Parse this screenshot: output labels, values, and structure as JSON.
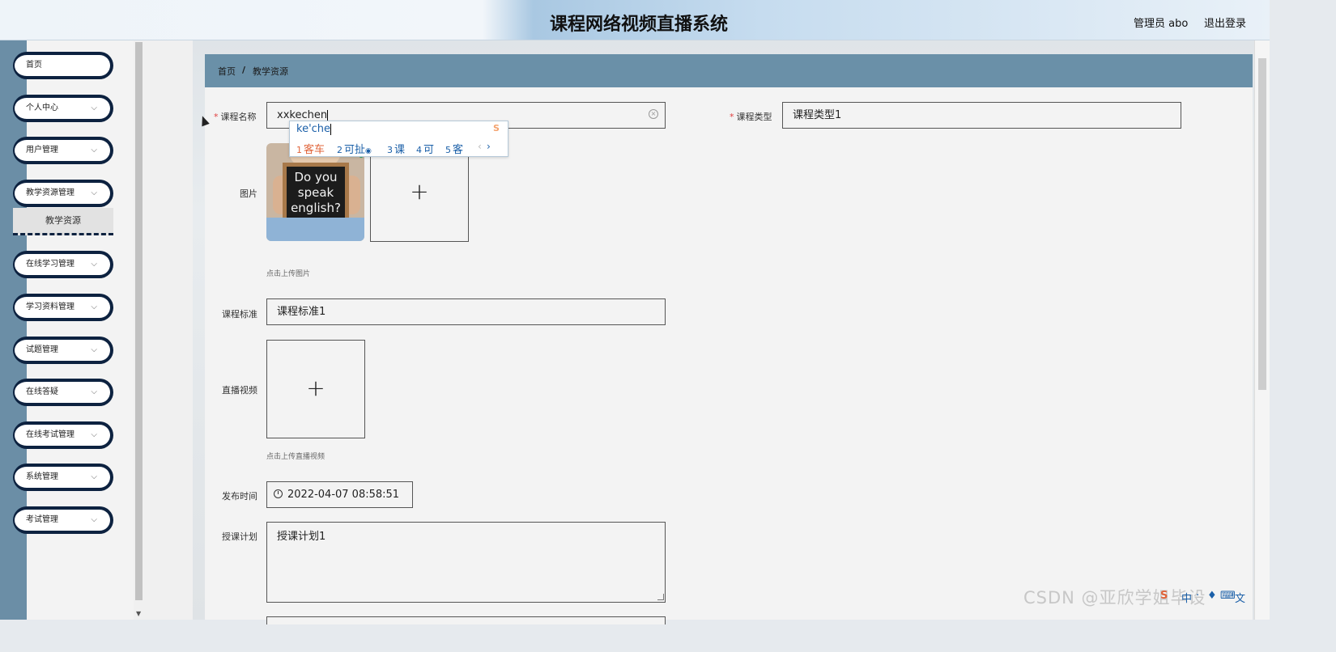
{
  "header": {
    "title": "课程网络视频直播系统",
    "user": "管理员 abo",
    "logout": "退出登录"
  },
  "sidebar": {
    "items": [
      {
        "label": "首页"
      },
      {
        "label": "个人中心"
      },
      {
        "label": "用户管理"
      },
      {
        "label": "教学资源管理"
      },
      {
        "label": "在线学习管理"
      },
      {
        "label": "学习资料管理"
      },
      {
        "label": "试题管理"
      },
      {
        "label": "在线答疑"
      },
      {
        "label": "在线考试管理"
      },
      {
        "label": "系统管理"
      },
      {
        "label": "考试管理"
      }
    ],
    "active_sub": "教学资源"
  },
  "breadcrumb": {
    "home": "首页",
    "sep": "/",
    "current": "教学资源"
  },
  "form": {
    "course_name": {
      "label": "课程名称",
      "value": "xxkechen",
      "required": "*"
    },
    "course_type": {
      "label": "课程类型",
      "value": "课程类型1",
      "required": "*"
    },
    "image": {
      "label": "图片",
      "hint": "点击上传图片",
      "board_text": "Do you speak english?"
    },
    "course_standard": {
      "label": "课程标准",
      "value": "课程标准1"
    },
    "live_video": {
      "label": "直播视频",
      "hint": "点击上传直播视频"
    },
    "publish_time": {
      "label": "发布时间",
      "value": "2022-04-07 08:58:51"
    },
    "teaching_plan": {
      "label": "授课计划",
      "value": "授课计划1"
    },
    "upload_plus": "+"
  },
  "ime": {
    "pinyin": "ke'che",
    "candidates": [
      {
        "num": "1",
        "text": "客车"
      },
      {
        "num": "2",
        "text": "可扯"
      },
      {
        "num": "3",
        "text": "课"
      },
      {
        "num": "4",
        "text": "可"
      },
      {
        "num": "5",
        "text": "客"
      }
    ],
    "prev": "‹",
    "next": "›"
  },
  "watermark": "CSDN @亚欣学姐毕设",
  "tray": [
    "中",
    "·",
    "♦",
    "⌨",
    "文"
  ],
  "colors": {
    "sidebar_stripe": "#6b8ea6",
    "menu_border": "#0d2240",
    "breadcrumb_bar": "#6a90a8",
    "required": "#e04040"
  }
}
